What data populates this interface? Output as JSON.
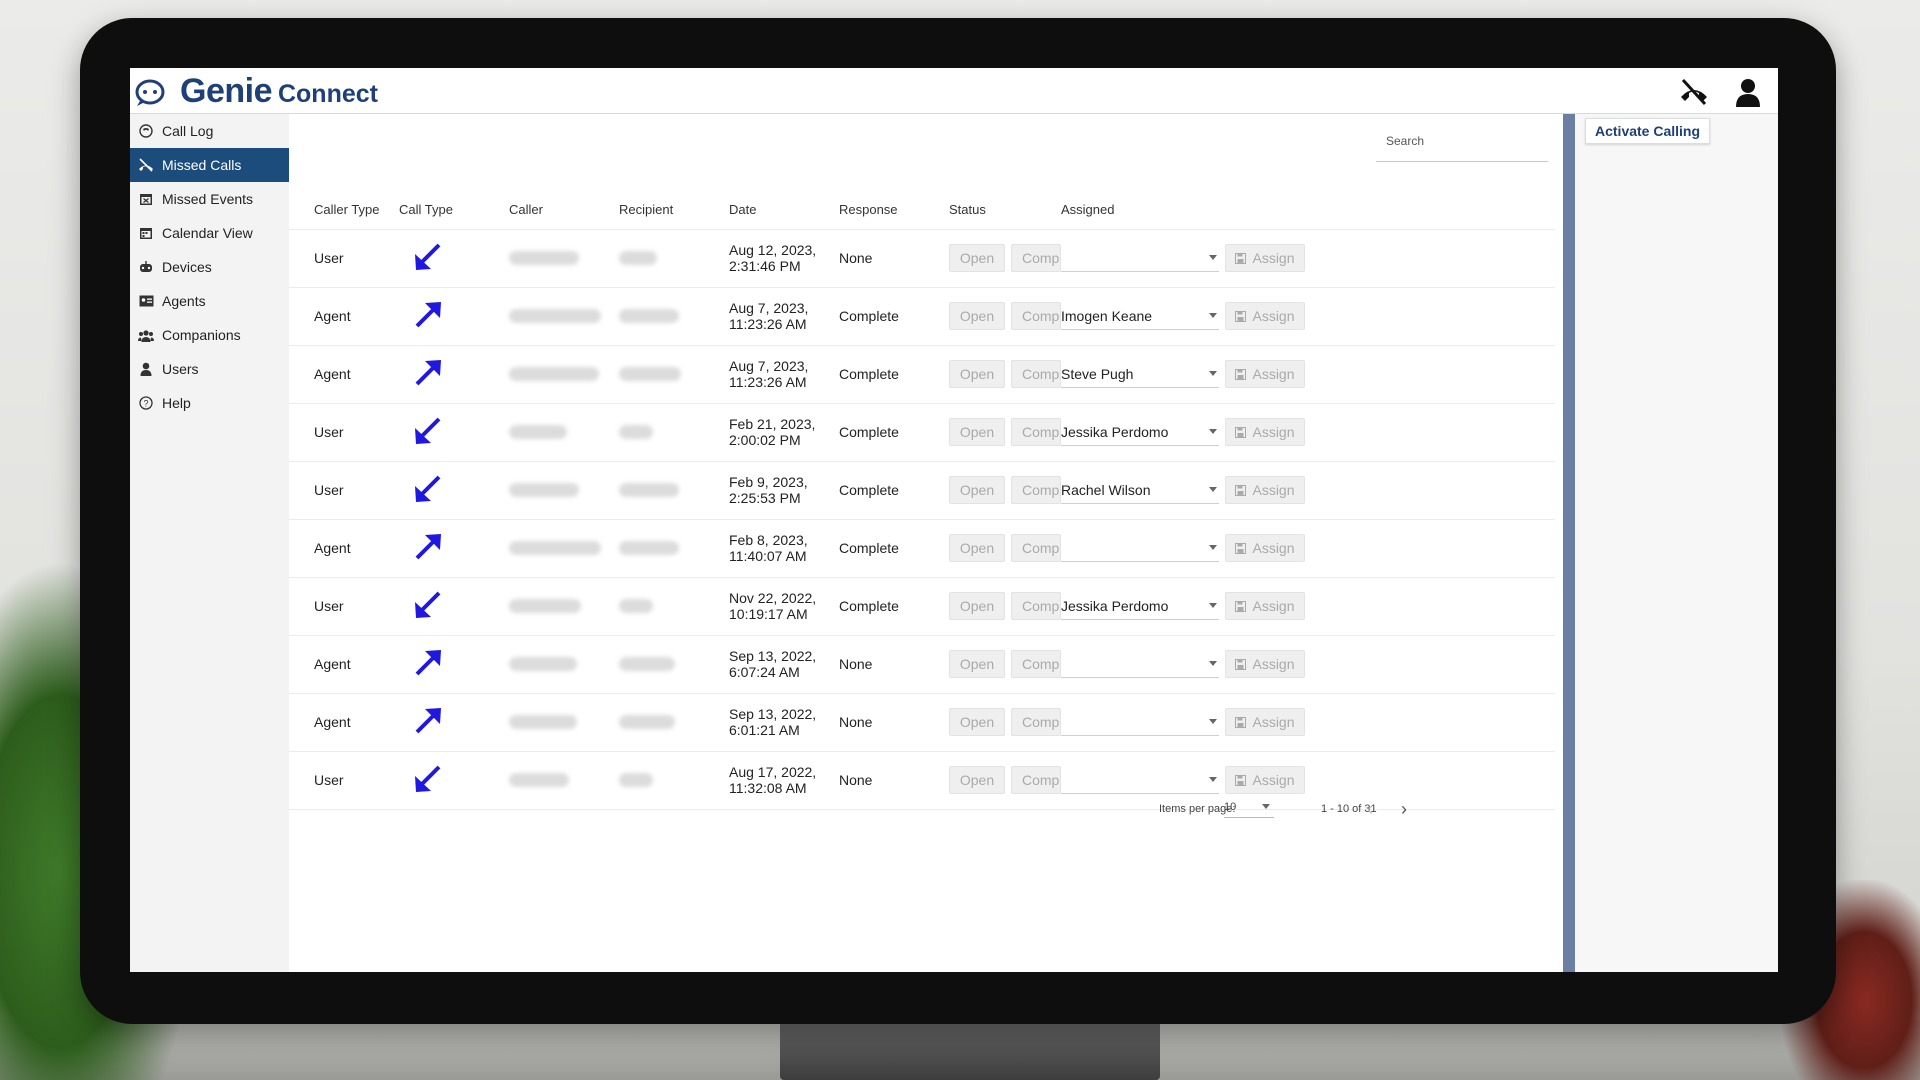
{
  "app": {
    "brand": "Genie",
    "product": "Connect"
  },
  "header": {
    "icons": [
      "phone-off-icon",
      "user-account-icon"
    ]
  },
  "sidebar": {
    "items": [
      {
        "label": "Call Log",
        "icon": "call-log-icon",
        "active": false
      },
      {
        "label": "Missed Calls",
        "icon": "missed-call-icon",
        "active": true
      },
      {
        "label": "Missed Events",
        "icon": "calendar-x-icon",
        "active": false
      },
      {
        "label": "Calendar View",
        "icon": "calendar-icon",
        "active": false
      },
      {
        "label": "Devices",
        "icon": "devices-icon",
        "active": false
      },
      {
        "label": "Agents",
        "icon": "id-card-icon",
        "active": false
      },
      {
        "label": "Companions",
        "icon": "users-group-icon",
        "active": false
      },
      {
        "label": "Users",
        "icon": "user-icon",
        "active": false
      },
      {
        "label": "Help",
        "icon": "help-circle-icon",
        "active": false
      }
    ]
  },
  "search": {
    "placeholder": "Search"
  },
  "table": {
    "headers": [
      "Caller Type",
      "Call Type",
      "Caller",
      "Recipient",
      "Date",
      "Response",
      "Status",
      "Assigned"
    ],
    "open_label": "Open",
    "comp_label": "Comp",
    "assign_label": "Assign",
    "rows": [
      {
        "caller_type": "User",
        "direction": "incoming",
        "date1": "Aug 12, 2023,",
        "date2": "2:31:46 PM",
        "response": "None",
        "assigned": ""
      },
      {
        "caller_type": "Agent",
        "direction": "outgoing",
        "date1": "Aug 7, 2023,",
        "date2": "11:23:26 AM",
        "response": "Complete",
        "assigned": "Imogen Keane"
      },
      {
        "caller_type": "Agent",
        "direction": "outgoing",
        "date1": "Aug 7, 2023,",
        "date2": "11:23:26 AM",
        "response": "Complete",
        "assigned": "Steve Pugh"
      },
      {
        "caller_type": "User",
        "direction": "incoming",
        "date1": "Feb 21, 2023,",
        "date2": "2:00:02 PM",
        "response": "Complete",
        "assigned": "Jessika Perdomo"
      },
      {
        "caller_type": "User",
        "direction": "incoming",
        "date1": "Feb 9, 2023,",
        "date2": "2:25:53 PM",
        "response": "Complete",
        "assigned": "Rachel Wilson"
      },
      {
        "caller_type": "Agent",
        "direction": "outgoing",
        "date1": "Feb 8, 2023,",
        "date2": "11:40:07 AM",
        "response": "Complete",
        "assigned": ""
      },
      {
        "caller_type": "User",
        "direction": "incoming",
        "date1": "Nov 22, 2022,",
        "date2": "10:19:17 AM",
        "response": "Complete",
        "assigned": "Jessika Perdomo"
      },
      {
        "caller_type": "Agent",
        "direction": "outgoing",
        "date1": "Sep 13, 2022,",
        "date2": "6:07:24 AM",
        "response": "None",
        "assigned": ""
      },
      {
        "caller_type": "Agent",
        "direction": "outgoing",
        "date1": "Sep 13, 2022,",
        "date2": "6:01:21 AM",
        "response": "None",
        "assigned": ""
      },
      {
        "caller_type": "User",
        "direction": "incoming",
        "date1": "Aug 17, 2022,",
        "date2": "11:32:08 AM",
        "response": "None",
        "assigned": ""
      }
    ]
  },
  "pagination": {
    "items_per_page_label": "Items per page:",
    "items_per_page_value": "10",
    "range_label": "1 - 10 of 31"
  },
  "right_panel": {
    "activate_label": "Activate Calling"
  },
  "colors": {
    "brand": "#1f3f78",
    "active_nav": "#1c4c7c",
    "arrow": "#2018e0",
    "panel_divider": "#6b7fa4"
  }
}
